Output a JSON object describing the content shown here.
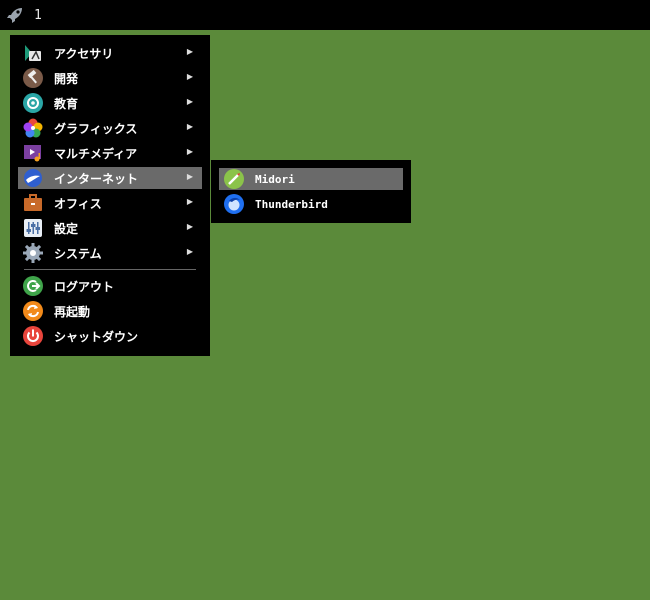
{
  "topbar": {
    "launcher_icon": "rocket-icon",
    "workspace": "1"
  },
  "menu": {
    "items": [
      {
        "label": "アクセサリ",
        "icon": "accessories-icon",
        "has_submenu": true
      },
      {
        "label": "開発",
        "icon": "hammer-icon",
        "has_submenu": true
      },
      {
        "label": "教育",
        "icon": "education-icon",
        "has_submenu": true
      },
      {
        "label": "グラフィックス",
        "icon": "graphics-icon",
        "has_submenu": true
      },
      {
        "label": "マルチメディア",
        "icon": "multimedia-icon",
        "has_submenu": true
      },
      {
        "label": "インターネット",
        "icon": "internet-icon",
        "has_submenu": true,
        "active": true
      },
      {
        "label": "オフィス",
        "icon": "office-icon",
        "has_submenu": true
      },
      {
        "label": "設定",
        "icon": "settings-icon",
        "has_submenu": true
      },
      {
        "label": "システム",
        "icon": "system-gear-icon",
        "has_submenu": true
      }
    ],
    "actions": [
      {
        "label": "ログアウト",
        "icon": "logout-icon"
      },
      {
        "label": "再起動",
        "icon": "restart-icon"
      },
      {
        "label": "シャットダウン",
        "icon": "power-icon"
      }
    ],
    "arrow": "▶"
  },
  "submenu": {
    "items": [
      {
        "label": "Midori",
        "icon": "midori-icon",
        "active": true
      },
      {
        "label": "Thunderbird",
        "icon": "thunderbird-icon"
      }
    ]
  },
  "colors": {
    "desktop": "#5b8a3a",
    "menu_bg": "#000000",
    "highlight": "#6a6a6a"
  }
}
